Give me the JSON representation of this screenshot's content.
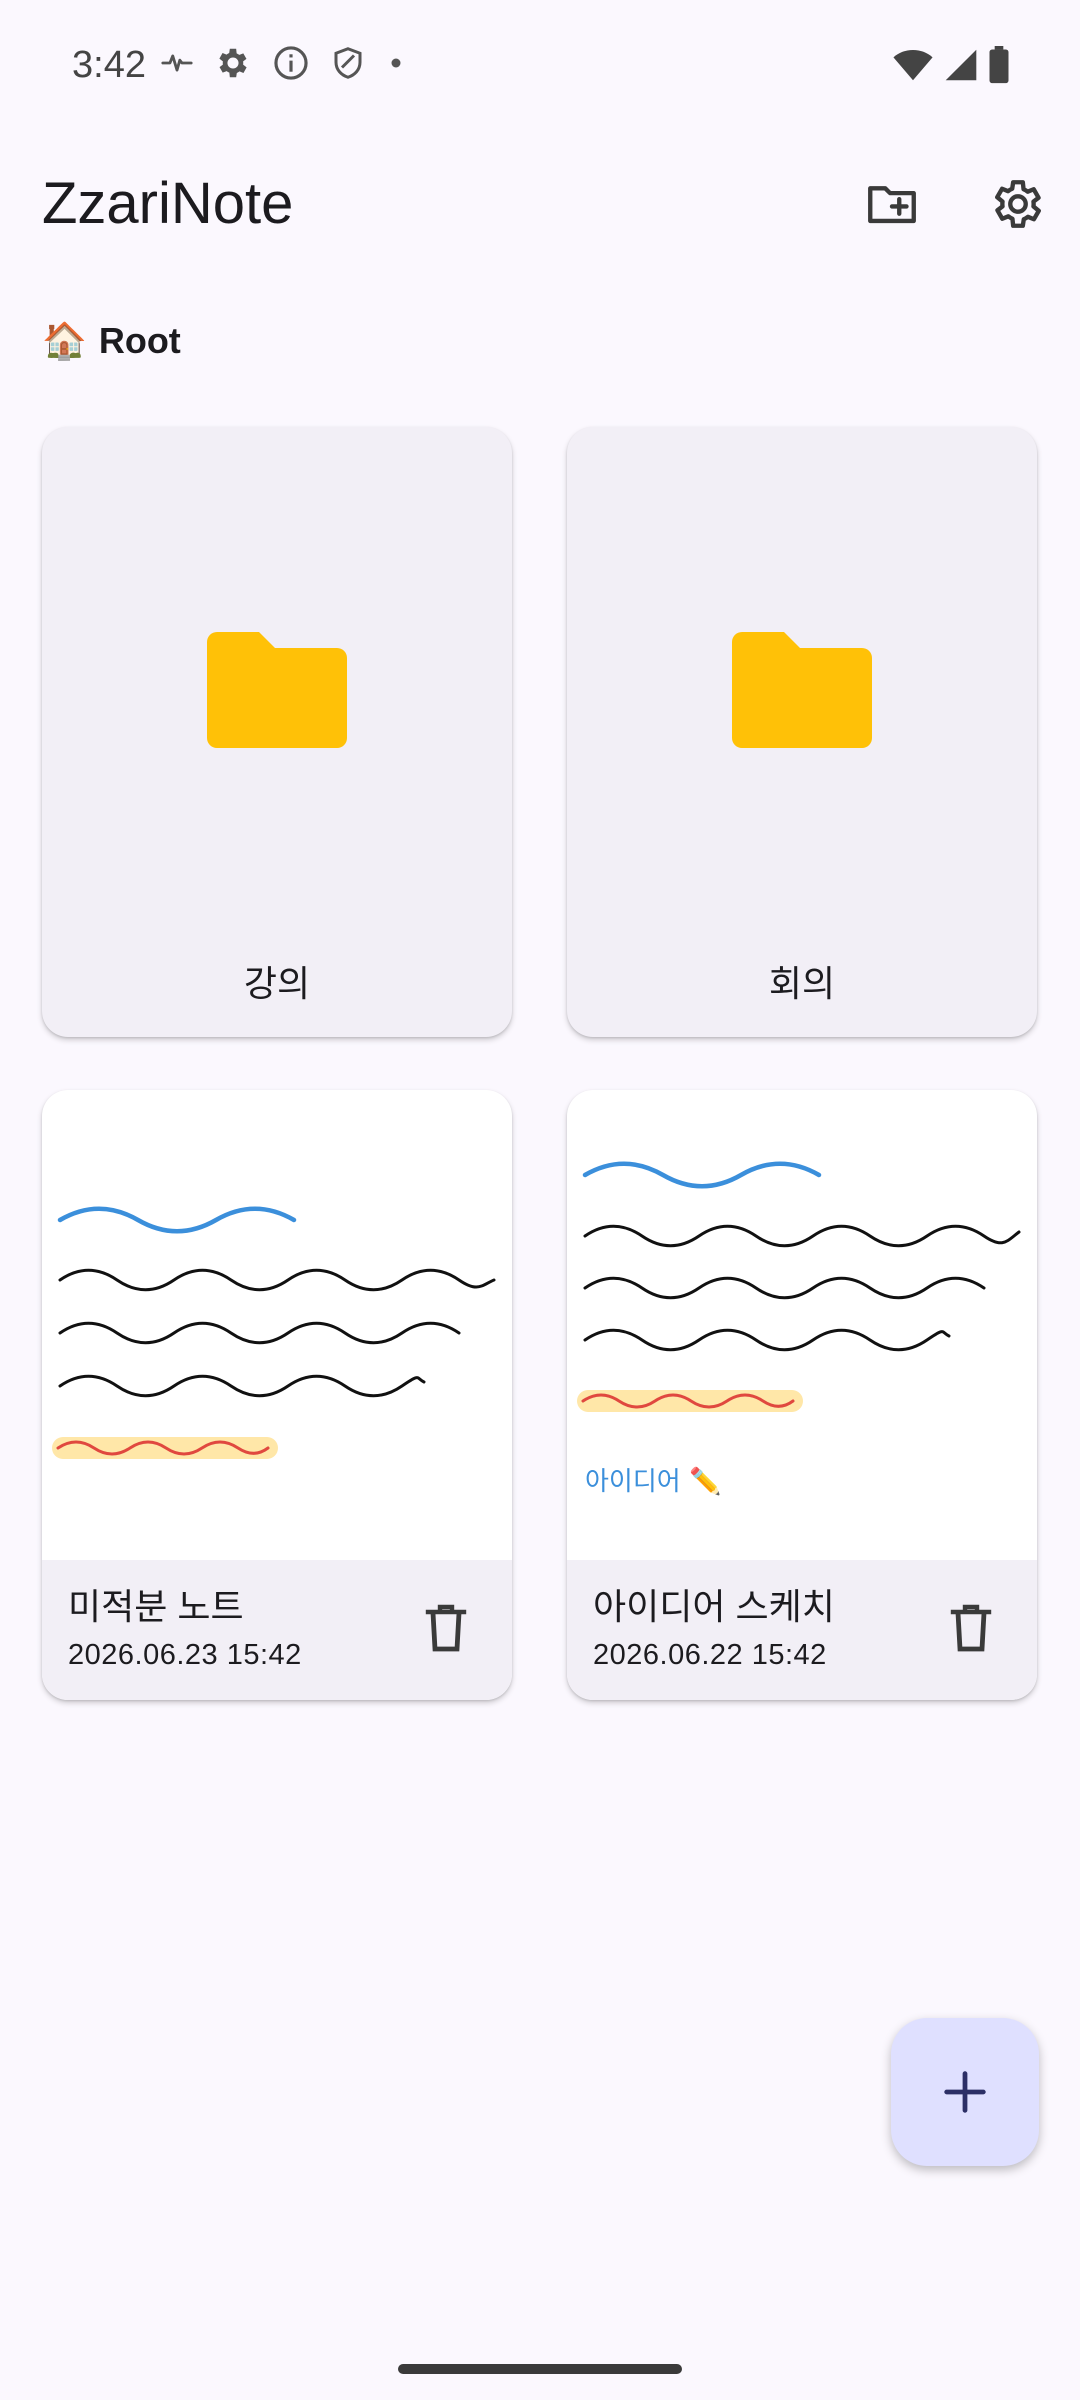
{
  "status_bar": {
    "time": "3:42",
    "icons": [
      "pulse-icon",
      "settings-gear-icon",
      "info-icon",
      "shield-icon",
      "dot-icon",
      "wifi-icon",
      "cell-signal-icon",
      "battery-icon"
    ]
  },
  "app_bar": {
    "title": "ZzariNote",
    "actions": [
      "new-folder-icon",
      "settings-icon"
    ]
  },
  "breadcrumb": {
    "icon": "🏠",
    "label": "Root"
  },
  "folders": [
    {
      "name": "강의"
    },
    {
      "name": "회의"
    }
  ],
  "notes": [
    {
      "title": "미적분 노트",
      "date": "2026.06.23 15:42"
    },
    {
      "title": "아이디어 스케치",
      "date": "2026.06.22 15:42",
      "preview_text": "아이디어 ✏️"
    }
  ],
  "fab": {
    "icon": "plus-icon"
  },
  "colors": {
    "background": "#FBF8FE",
    "card": "#F2EFF6",
    "folder": "#FFC107",
    "fab": "#DFE0FF",
    "ink_blue": "#3B8FDB",
    "ink_black": "#111111",
    "ink_red": "#E0483F",
    "highlight": "#FFE7A8"
  }
}
